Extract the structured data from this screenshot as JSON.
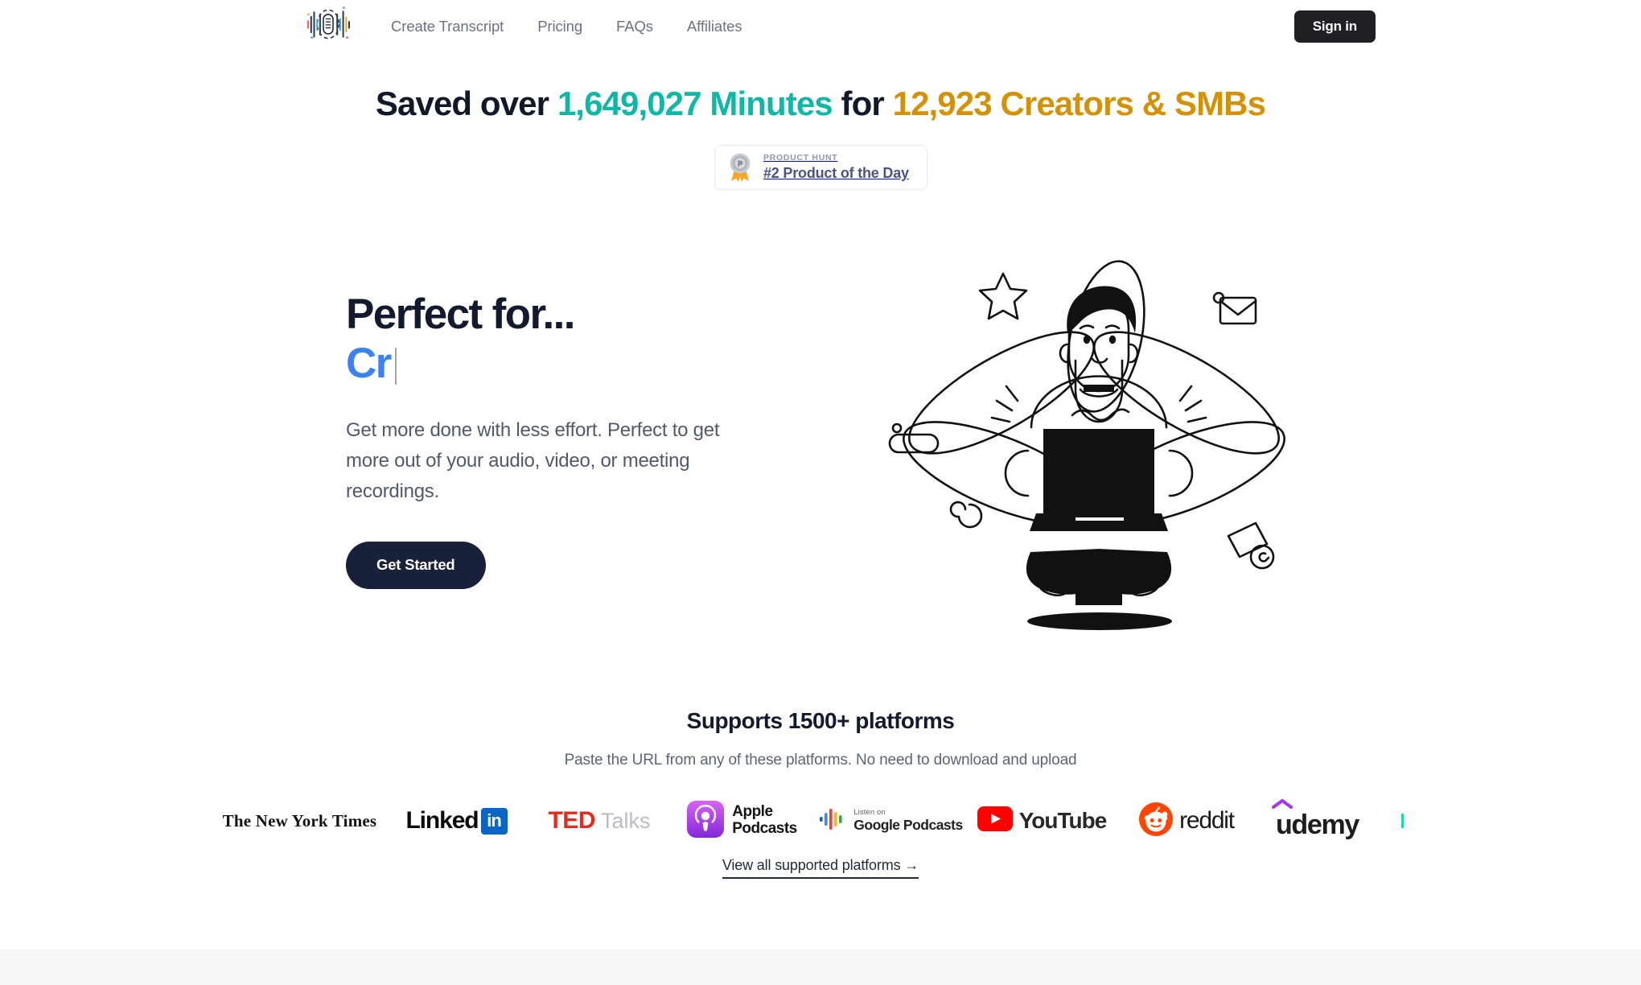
{
  "brand": {
    "logo_icon": "microphone-waveform-logo"
  },
  "nav": {
    "links": [
      {
        "label": "Create Transcript",
        "name": "nav-link-create-transcript"
      },
      {
        "label": "Pricing",
        "name": "nav-link-pricing"
      },
      {
        "label": "FAQs",
        "name": "nav-link-faqs"
      },
      {
        "label": "Affiliates",
        "name": "nav-link-affiliates"
      }
    ],
    "signin_label": "Sign in"
  },
  "stat_banner": {
    "prefix": "Saved over",
    "minutes_value": "1,649,027",
    "minutes_word": "Minutes",
    "middle": "for",
    "creators_value": "12,923",
    "creators_word": "Creators & SMBs",
    "minutes_color": "#0fb8a6",
    "creators_color": "#d39205"
  },
  "product_hunt": {
    "kicker": "PRODUCT HUNT",
    "title": "#2 Product of the Day",
    "medal_icon": "product-hunt-medal-icon"
  },
  "hero": {
    "heading_static": "Perfect for...",
    "heading_typed": "Cr",
    "typed_color": "#3b82f6",
    "subtext": "Get more done with less effort. Perfect to get more out of your audio, video, or meeting recordings.",
    "cta_label": "Get Started",
    "illustration_name": "person-with-laptop-illustration"
  },
  "platforms": {
    "title": "Supports 1500+ platforms",
    "subtitle": "Paste the URL from any of these platforms. No need to download and upload",
    "logos": [
      {
        "name": "logo-new-york-times",
        "text": "The New York Times"
      },
      {
        "name": "logo-linkedin",
        "text": "Linked",
        "badge": "in"
      },
      {
        "name": "logo-ted-talks",
        "text": "TED",
        "secondary": "Talks"
      },
      {
        "name": "logo-apple-podcasts",
        "text": "Apple",
        "secondary": "Podcasts"
      },
      {
        "name": "logo-google-podcasts",
        "text": "Google Podcasts",
        "kicker": "Listen on"
      },
      {
        "name": "logo-youtube",
        "text": "YouTube"
      },
      {
        "name": "logo-reddit",
        "text": "reddit"
      },
      {
        "name": "logo-udemy",
        "text": "udemy"
      }
    ],
    "view_all_label": "View all supported platforms  →"
  }
}
